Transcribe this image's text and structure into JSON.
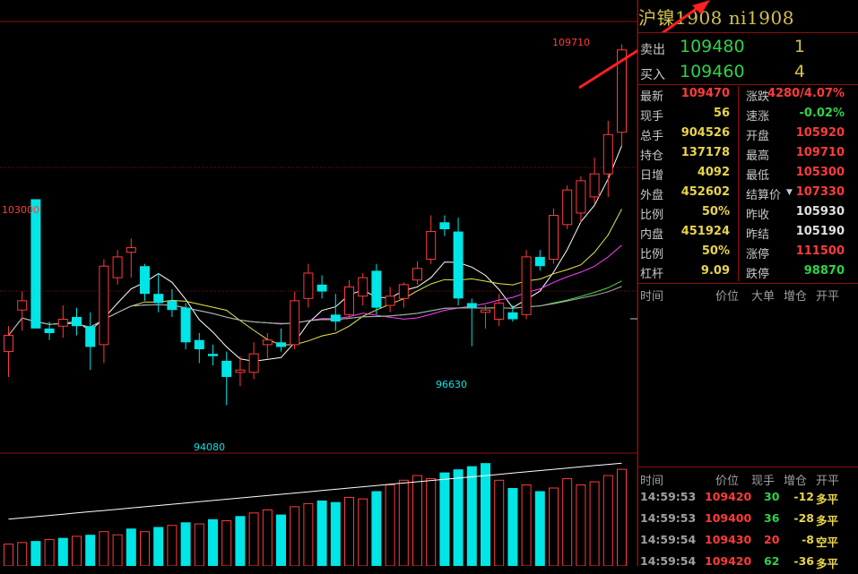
{
  "contract": {
    "title": "沪镍1908 ni1908"
  },
  "orderbook": {
    "ask": {
      "label": "卖出",
      "price": "109480",
      "volume": "1"
    },
    "bid": {
      "label": "买入",
      "price": "109460",
      "volume": "4"
    }
  },
  "quotes": [
    {
      "label": "最新",
      "value": "109470",
      "value_color": "#ff3b3b",
      "label2": "涨跌",
      "value2": "4280/4.07%",
      "value2_color": "#ff3b3b"
    },
    {
      "label": "现手",
      "value": "56",
      "value_color": "#e8d44a",
      "label2": "速涨",
      "value2": "-0.02%",
      "value2_color": "#2fd24a"
    },
    {
      "label": "总手",
      "value": "904526",
      "value_color": "#e8d44a",
      "label2": "开盘",
      "value2": "105920",
      "value2_color": "#ff3b3b"
    },
    {
      "label": "持仓",
      "value": "137178",
      "value_color": "#e8d44a",
      "label2": "最高",
      "value2": "109710",
      "value2_color": "#ff3b3b"
    },
    {
      "label": "日增",
      "value": "4092",
      "value_color": "#e8d44a",
      "label2": "最低",
      "value2": "105300",
      "value2_color": "#ff3b3b"
    },
    {
      "label": "外盘",
      "value": "452602",
      "value_color": "#e8d44a",
      "label2": "结算价",
      "value2": "107330",
      "value2_color": "#ff3b3b"
    },
    {
      "label": "比例",
      "value": "50%",
      "value_color": "#e8d44a",
      "label2": "昨收",
      "value2": "105930",
      "value2_color": "#e0e0e0"
    },
    {
      "label": "内盘",
      "value": "451924",
      "value_color": "#e8d44a",
      "label2": "昨结",
      "value2": "105190",
      "value2_color": "#e0e0e0"
    },
    {
      "label": "比例",
      "value": "50%",
      "value_color": "#e8d44a",
      "label2": "涨停",
      "value2": "111500",
      "value2_color": "#ff3b3b"
    },
    {
      "label": "杠杆",
      "value": "9.09",
      "value_color": "#e8d44a",
      "label2": "跌停",
      "value2": "98870",
      "value2_color": "#2fd24a"
    }
  ],
  "bigorder_header": {
    "time": "时间",
    "price": "价位",
    "big": "大单",
    "oi": "增仓",
    "type": "开平"
  },
  "trades_header": {
    "time": "时间",
    "price": "价位",
    "hand": "现手",
    "oi": "增仓",
    "type": "开平"
  },
  "trades": [
    {
      "time": "14:59:53",
      "price": "109420",
      "hand": "30",
      "oi": "-12",
      "type": "多平"
    },
    {
      "time": "14:59:53",
      "price": "109400",
      "hand": "36",
      "oi": "-28",
      "type": "多平"
    },
    {
      "time": "14:59:54",
      "price": "109430",
      "hand": "20",
      "oi": "-8",
      "type": "空平"
    },
    {
      "time": "14:59:54",
      "price": "109420",
      "hand": "62",
      "oi": "-36",
      "type": "多平"
    }
  ],
  "chart_labels": {
    "high": "109710",
    "mark_103000": "103000",
    "low_94080": "94080",
    "low_96630": "96630"
  },
  "colors": {
    "up": "#ff3b3b",
    "down": "#00e5e5",
    "grid": "#8b1010",
    "arrow": "#ff2020"
  },
  "chart_data": {
    "type": "candlestick",
    "candles": [
      {
        "o": 96400,
        "h": 97500,
        "l": 95300,
        "c": 97100
      },
      {
        "o": 98200,
        "h": 99000,
        "l": 97300,
        "c": 98600
      },
      {
        "o": 103000,
        "h": 103000,
        "l": 97400,
        "c": 97400
      },
      {
        "o": 97400,
        "h": 97700,
        "l": 96900,
        "c": 97200
      },
      {
        "o": 97500,
        "h": 98400,
        "l": 97000,
        "c": 97800
      },
      {
        "o": 97900,
        "h": 98300,
        "l": 97100,
        "c": 97500
      },
      {
        "o": 97500,
        "h": 98100,
        "l": 95600,
        "c": 96600
      },
      {
        "o": 96700,
        "h": 100400,
        "l": 95900,
        "c": 100100
      },
      {
        "o": 99600,
        "h": 100800,
        "l": 99300,
        "c": 100500
      },
      {
        "o": 100700,
        "h": 101300,
        "l": 99600,
        "c": 100900
      },
      {
        "o": 100100,
        "h": 100200,
        "l": 98600,
        "c": 98900
      },
      {
        "o": 98900,
        "h": 99800,
        "l": 98100,
        "c": 98500
      },
      {
        "o": 98600,
        "h": 99100,
        "l": 97900,
        "c": 98200
      },
      {
        "o": 98300,
        "h": 98500,
        "l": 96500,
        "c": 96800
      },
      {
        "o": 96900,
        "h": 97200,
        "l": 95900,
        "c": 96500
      },
      {
        "o": 96300,
        "h": 96700,
        "l": 95800,
        "c": 96200
      },
      {
        "o": 96000,
        "h": 96400,
        "l": 94080,
        "c": 95300
      },
      {
        "o": 95500,
        "h": 96200,
        "l": 94900,
        "c": 95600
      },
      {
        "o": 95500,
        "h": 96800,
        "l": 95200,
        "c": 96300
      },
      {
        "o": 96700,
        "h": 97200,
        "l": 96100,
        "c": 96900
      },
      {
        "o": 96800,
        "h": 97400,
        "l": 96400,
        "c": 96600
      },
      {
        "o": 96700,
        "h": 99000,
        "l": 96500,
        "c": 98600
      },
      {
        "o": 98700,
        "h": 100200,
        "l": 98300,
        "c": 99800
      },
      {
        "o": 99300,
        "h": 99700,
        "l": 98700,
        "c": 99000
      },
      {
        "o": 98000,
        "h": 98900,
        "l": 97300,
        "c": 97700
      },
      {
        "o": 98000,
        "h": 99500,
        "l": 97800,
        "c": 99200
      },
      {
        "o": 98800,
        "h": 99800,
        "l": 98400,
        "c": 99600
      },
      {
        "o": 99900,
        "h": 100200,
        "l": 98000,
        "c": 98300
      },
      {
        "o": 98400,
        "h": 99200,
        "l": 98100,
        "c": 98800
      },
      {
        "o": 98700,
        "h": 99400,
        "l": 98300,
        "c": 99300
      },
      {
        "o": 99500,
        "h": 100300,
        "l": 99300,
        "c": 100000
      },
      {
        "o": 100400,
        "h": 102300,
        "l": 100200,
        "c": 101600
      },
      {
        "o": 102000,
        "h": 102300,
        "l": 101400,
        "c": 101700
      },
      {
        "o": 101600,
        "h": 102200,
        "l": 98400,
        "c": 98700
      },
      {
        "o": 98500,
        "h": 98700,
        "l": 96630,
        "c": 98300
      },
      {
        "o": 98100,
        "h": 98400,
        "l": 97400,
        "c": 98200
      },
      {
        "o": 97800,
        "h": 98900,
        "l": 97500,
        "c": 98500
      },
      {
        "o": 98100,
        "h": 98400,
        "l": 97700,
        "c": 97800
      },
      {
        "o": 98000,
        "h": 100800,
        "l": 97800,
        "c": 100500
      },
      {
        "o": 100500,
        "h": 100800,
        "l": 99900,
        "c": 100100
      },
      {
        "o": 100400,
        "h": 102600,
        "l": 100200,
        "c": 102300
      },
      {
        "o": 101900,
        "h": 103600,
        "l": 101700,
        "c": 103400
      },
      {
        "o": 102400,
        "h": 104000,
        "l": 102000,
        "c": 103800
      },
      {
        "o": 103100,
        "h": 104800,
        "l": 102800,
        "c": 104100
      },
      {
        "o": 104100,
        "h": 106400,
        "l": 103100,
        "c": 105800
      },
      {
        "o": 105900,
        "h": 109710,
        "l": 105300,
        "c": 109470
      }
    ],
    "volume_pct": [
      0.14,
      0.15,
      0.16,
      0.17,
      0.18,
      0.19,
      0.2,
      0.22,
      0.2,
      0.24,
      0.22,
      0.25,
      0.26,
      0.28,
      0.27,
      0.3,
      0.29,
      0.32,
      0.34,
      0.36,
      0.33,
      0.38,
      0.4,
      0.42,
      0.41,
      0.44,
      0.43,
      0.48,
      0.52,
      0.55,
      0.58,
      0.56,
      0.6,
      0.62,
      0.64,
      0.66,
      0.55,
      0.5,
      0.52,
      0.48,
      0.5,
      0.56,
      0.52,
      0.54,
      0.58,
      0.62
    ],
    "volume_color_up": [
      true,
      true,
      false,
      true,
      false,
      true,
      false,
      true,
      true,
      false,
      true,
      false,
      true,
      false,
      true,
      false,
      true,
      false,
      true,
      true,
      false,
      true,
      true,
      false,
      false,
      true,
      true,
      false,
      true,
      true,
      true,
      true,
      false,
      false,
      false,
      false,
      true,
      false,
      true,
      false,
      true,
      true,
      true,
      true,
      true,
      true
    ]
  }
}
